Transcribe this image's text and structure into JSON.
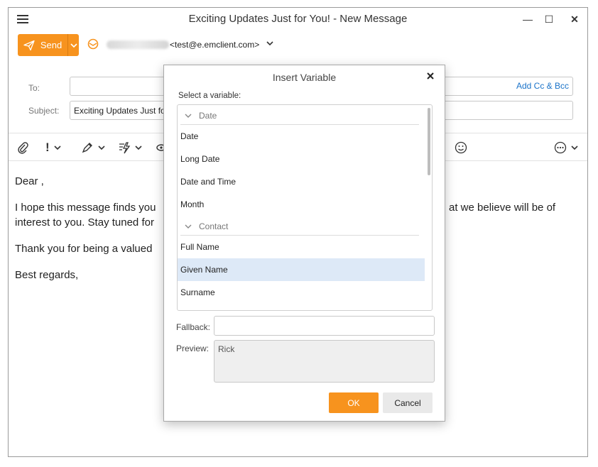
{
  "window": {
    "title": "Exciting Updates Just for You! - New Message",
    "controls": {
      "minimize": "—",
      "maximize": "☐",
      "close": "✕"
    }
  },
  "compose": {
    "send_label": "Send",
    "from_email": "<test@e.emclient.com>",
    "to_label": "To:",
    "to_value": "",
    "subject_label": "Subject:",
    "subject_value": "Exciting Updates Just for You!",
    "add_cc_bcc": "Add Cc & Bcc"
  },
  "toolbar": {
    "icons": [
      "paperclip-icon",
      "priority-icon",
      "signature-icon",
      "quick-text-icon",
      "view-icon",
      "emoji-icon",
      "more-icon"
    ]
  },
  "body": {
    "lines": [
      "Dear ,",
      "I hope this message finds you",
      "interest to you. Stay tuned for",
      "Thank you for being a valued",
      "Best regards,"
    ],
    "line1_tail": "at we believe will be of"
  },
  "dialog": {
    "title": "Insert Variable",
    "select_label": "Select a variable:",
    "groups": [
      {
        "name": "Date",
        "items": [
          "Date",
          "Long Date",
          "Date and Time",
          "Month"
        ]
      },
      {
        "name": "Contact",
        "items": [
          "Full Name",
          "Given Name",
          "Surname"
        ]
      }
    ],
    "selected": "Given Name",
    "fallback_label": "Fallback:",
    "fallback_value": "",
    "preview_label": "Preview:",
    "preview_value": "Rick",
    "ok_label": "OK",
    "cancel_label": "Cancel"
  },
  "colors": {
    "accent": "#f7931e",
    "link": "#1a73c9",
    "selection": "#dde9f7"
  }
}
